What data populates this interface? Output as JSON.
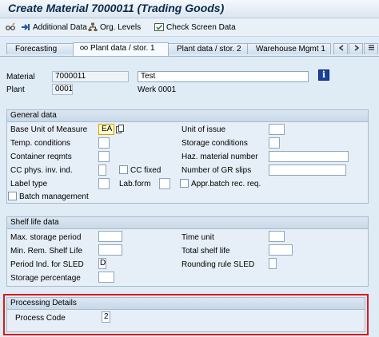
{
  "title": "Create Material 7000011 (Trading Goods)",
  "toolbar": {
    "items": [
      "Additional Data",
      "Org. Levels",
      "Check Screen Data"
    ]
  },
  "tabs": [
    "Forecasting",
    "Plant data / stor. 1",
    "Plant data / stor. 2",
    "Warehouse Mgmt 1"
  ],
  "header": {
    "material_label": "Material",
    "material_value": "7000011",
    "material_desc": "Test",
    "plant_label": "Plant",
    "plant_value": "0001",
    "plant_name": "Werk 0001"
  },
  "general": {
    "title": "General data",
    "buom_label": "Base Unit of Measure",
    "buom_value": "EA",
    "temp_label": "Temp. conditions",
    "container_label": "Container reqmts",
    "cc_label": "CC phys. inv. ind.",
    "ccfixed_label": "CC fixed",
    "labeltype_label": "Label type",
    "labform_label": "Lab.form",
    "batch_label": "Batch management",
    "issue_label": "Unit of issue",
    "storage_label": "Storage conditions",
    "haz_label": "Haz. material number",
    "gr_label": "Number of GR slips",
    "apprbatch_label": "Appr.batch rec. req."
  },
  "shelf": {
    "title": "Shelf life data",
    "maxstorage_label": "Max. storage period",
    "minrem_label": "Min. Rem. Shelf Life",
    "period_label": "Period Ind. for SLED",
    "period_value": "D",
    "storagepct_label": "Storage percentage",
    "timeunit_label": "Time unit",
    "total_label": "Total shelf life",
    "rounding_label": "Rounding rule SLED"
  },
  "processing": {
    "title": "Processing Details",
    "code_label": "Process Code",
    "code_value": "2"
  },
  "colors": {
    "highlight": "#e0171b",
    "required_bg": "#fffbc8"
  },
  "icons": [
    "glasses-icon",
    "additional-data-icon",
    "org-levels-icon",
    "check-screen-icon",
    "info-icon",
    "copy-icon"
  ]
}
